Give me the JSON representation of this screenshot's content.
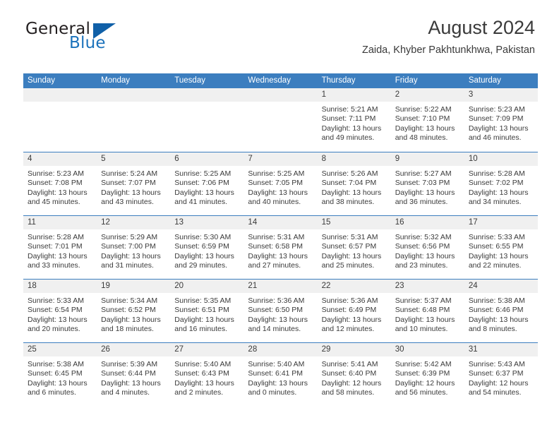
{
  "brand": {
    "name_top": "General",
    "name_bottom": "Blue",
    "accent_color": "#1b72bb",
    "triangle_color": "#1060a8"
  },
  "header": {
    "title": "August 2024",
    "subtitle": "Zaida, Khyber Pakhtunkhwa, Pakistan"
  },
  "calendar": {
    "header_bg": "#3c7ebf",
    "weekdays": [
      "Sunday",
      "Monday",
      "Tuesday",
      "Wednesday",
      "Thursday",
      "Friday",
      "Saturday"
    ],
    "weeks": [
      [
        {
          "day": "",
          "sunrise": "",
          "sunset": "",
          "daylight1": "",
          "daylight2": "",
          "empty": true
        },
        {
          "day": "",
          "sunrise": "",
          "sunset": "",
          "daylight1": "",
          "daylight2": "",
          "empty": true
        },
        {
          "day": "",
          "sunrise": "",
          "sunset": "",
          "daylight1": "",
          "daylight2": "",
          "empty": true
        },
        {
          "day": "",
          "sunrise": "",
          "sunset": "",
          "daylight1": "",
          "daylight2": "",
          "empty": true
        },
        {
          "day": "1",
          "sunrise": "Sunrise: 5:21 AM",
          "sunset": "Sunset: 7:11 PM",
          "daylight1": "Daylight: 13 hours",
          "daylight2": "and 49 minutes."
        },
        {
          "day": "2",
          "sunrise": "Sunrise: 5:22 AM",
          "sunset": "Sunset: 7:10 PM",
          "daylight1": "Daylight: 13 hours",
          "daylight2": "and 48 minutes."
        },
        {
          "day": "3",
          "sunrise": "Sunrise: 5:23 AM",
          "sunset": "Sunset: 7:09 PM",
          "daylight1": "Daylight: 13 hours",
          "daylight2": "and 46 minutes."
        }
      ],
      [
        {
          "day": "4",
          "sunrise": "Sunrise: 5:23 AM",
          "sunset": "Sunset: 7:08 PM",
          "daylight1": "Daylight: 13 hours",
          "daylight2": "and 45 minutes."
        },
        {
          "day": "5",
          "sunrise": "Sunrise: 5:24 AM",
          "sunset": "Sunset: 7:07 PM",
          "daylight1": "Daylight: 13 hours",
          "daylight2": "and 43 minutes."
        },
        {
          "day": "6",
          "sunrise": "Sunrise: 5:25 AM",
          "sunset": "Sunset: 7:06 PM",
          "daylight1": "Daylight: 13 hours",
          "daylight2": "and 41 minutes."
        },
        {
          "day": "7",
          "sunrise": "Sunrise: 5:25 AM",
          "sunset": "Sunset: 7:05 PM",
          "daylight1": "Daylight: 13 hours",
          "daylight2": "and 40 minutes."
        },
        {
          "day": "8",
          "sunrise": "Sunrise: 5:26 AM",
          "sunset": "Sunset: 7:04 PM",
          "daylight1": "Daylight: 13 hours",
          "daylight2": "and 38 minutes."
        },
        {
          "day": "9",
          "sunrise": "Sunrise: 5:27 AM",
          "sunset": "Sunset: 7:03 PM",
          "daylight1": "Daylight: 13 hours",
          "daylight2": "and 36 minutes."
        },
        {
          "day": "10",
          "sunrise": "Sunrise: 5:28 AM",
          "sunset": "Sunset: 7:02 PM",
          "daylight1": "Daylight: 13 hours",
          "daylight2": "and 34 minutes."
        }
      ],
      [
        {
          "day": "11",
          "sunrise": "Sunrise: 5:28 AM",
          "sunset": "Sunset: 7:01 PM",
          "daylight1": "Daylight: 13 hours",
          "daylight2": "and 33 minutes."
        },
        {
          "day": "12",
          "sunrise": "Sunrise: 5:29 AM",
          "sunset": "Sunset: 7:00 PM",
          "daylight1": "Daylight: 13 hours",
          "daylight2": "and 31 minutes."
        },
        {
          "day": "13",
          "sunrise": "Sunrise: 5:30 AM",
          "sunset": "Sunset: 6:59 PM",
          "daylight1": "Daylight: 13 hours",
          "daylight2": "and 29 minutes."
        },
        {
          "day": "14",
          "sunrise": "Sunrise: 5:31 AM",
          "sunset": "Sunset: 6:58 PM",
          "daylight1": "Daylight: 13 hours",
          "daylight2": "and 27 minutes."
        },
        {
          "day": "15",
          "sunrise": "Sunrise: 5:31 AM",
          "sunset": "Sunset: 6:57 PM",
          "daylight1": "Daylight: 13 hours",
          "daylight2": "and 25 minutes."
        },
        {
          "day": "16",
          "sunrise": "Sunrise: 5:32 AM",
          "sunset": "Sunset: 6:56 PM",
          "daylight1": "Daylight: 13 hours",
          "daylight2": "and 23 minutes."
        },
        {
          "day": "17",
          "sunrise": "Sunrise: 5:33 AM",
          "sunset": "Sunset: 6:55 PM",
          "daylight1": "Daylight: 13 hours",
          "daylight2": "and 22 minutes."
        }
      ],
      [
        {
          "day": "18",
          "sunrise": "Sunrise: 5:33 AM",
          "sunset": "Sunset: 6:54 PM",
          "daylight1": "Daylight: 13 hours",
          "daylight2": "and 20 minutes."
        },
        {
          "day": "19",
          "sunrise": "Sunrise: 5:34 AM",
          "sunset": "Sunset: 6:52 PM",
          "daylight1": "Daylight: 13 hours",
          "daylight2": "and 18 minutes."
        },
        {
          "day": "20",
          "sunrise": "Sunrise: 5:35 AM",
          "sunset": "Sunset: 6:51 PM",
          "daylight1": "Daylight: 13 hours",
          "daylight2": "and 16 minutes."
        },
        {
          "day": "21",
          "sunrise": "Sunrise: 5:36 AM",
          "sunset": "Sunset: 6:50 PM",
          "daylight1": "Daylight: 13 hours",
          "daylight2": "and 14 minutes."
        },
        {
          "day": "22",
          "sunrise": "Sunrise: 5:36 AM",
          "sunset": "Sunset: 6:49 PM",
          "daylight1": "Daylight: 13 hours",
          "daylight2": "and 12 minutes."
        },
        {
          "day": "23",
          "sunrise": "Sunrise: 5:37 AM",
          "sunset": "Sunset: 6:48 PM",
          "daylight1": "Daylight: 13 hours",
          "daylight2": "and 10 minutes."
        },
        {
          "day": "24",
          "sunrise": "Sunrise: 5:38 AM",
          "sunset": "Sunset: 6:46 PM",
          "daylight1": "Daylight: 13 hours",
          "daylight2": "and 8 minutes."
        }
      ],
      [
        {
          "day": "25",
          "sunrise": "Sunrise: 5:38 AM",
          "sunset": "Sunset: 6:45 PM",
          "daylight1": "Daylight: 13 hours",
          "daylight2": "and 6 minutes."
        },
        {
          "day": "26",
          "sunrise": "Sunrise: 5:39 AM",
          "sunset": "Sunset: 6:44 PM",
          "daylight1": "Daylight: 13 hours",
          "daylight2": "and 4 minutes."
        },
        {
          "day": "27",
          "sunrise": "Sunrise: 5:40 AM",
          "sunset": "Sunset: 6:43 PM",
          "daylight1": "Daylight: 13 hours",
          "daylight2": "and 2 minutes."
        },
        {
          "day": "28",
          "sunrise": "Sunrise: 5:40 AM",
          "sunset": "Sunset: 6:41 PM",
          "daylight1": "Daylight: 13 hours",
          "daylight2": "and 0 minutes."
        },
        {
          "day": "29",
          "sunrise": "Sunrise: 5:41 AM",
          "sunset": "Sunset: 6:40 PM",
          "daylight1": "Daylight: 12 hours",
          "daylight2": "and 58 minutes."
        },
        {
          "day": "30",
          "sunrise": "Sunrise: 5:42 AM",
          "sunset": "Sunset: 6:39 PM",
          "daylight1": "Daylight: 12 hours",
          "daylight2": "and 56 minutes."
        },
        {
          "day": "31",
          "sunrise": "Sunrise: 5:43 AM",
          "sunset": "Sunset: 6:37 PM",
          "daylight1": "Daylight: 12 hours",
          "daylight2": "and 54 minutes."
        }
      ]
    ]
  }
}
